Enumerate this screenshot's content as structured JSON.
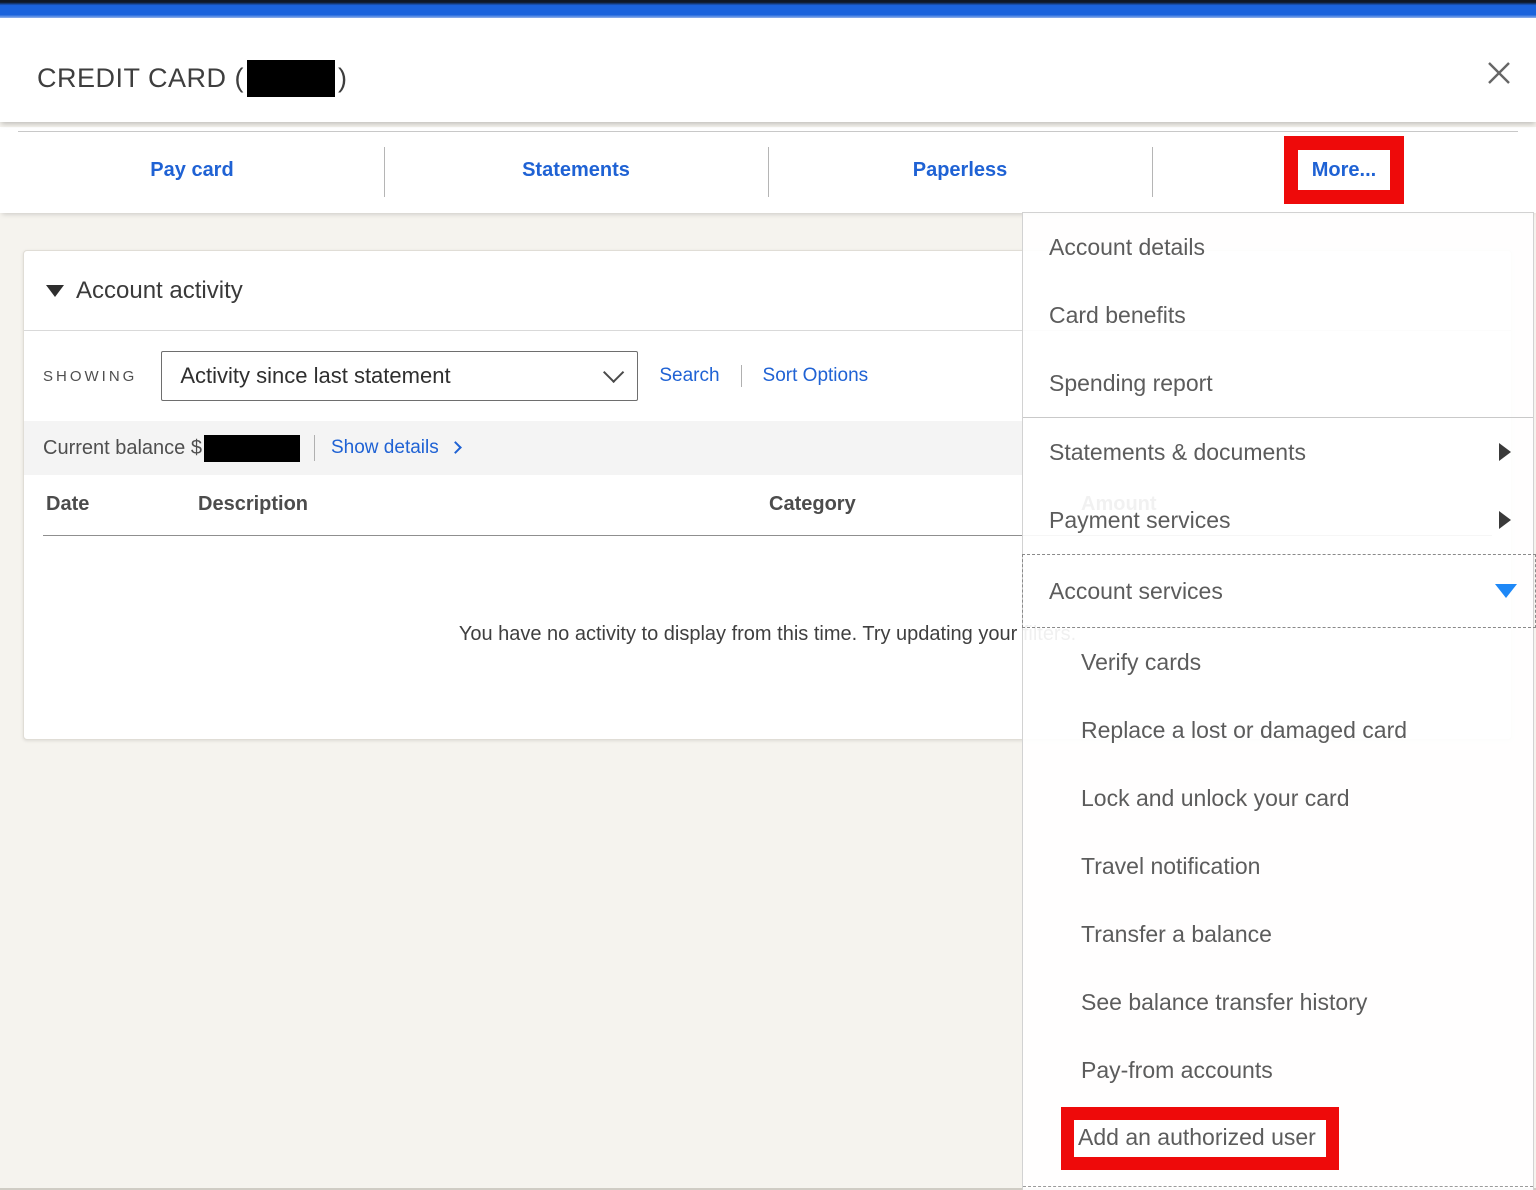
{
  "window": {
    "title_prefix": "CREDIT CARD (",
    "title_suffix": ")"
  },
  "tabs": [
    {
      "label": "Pay card"
    },
    {
      "label": "Statements"
    },
    {
      "label": "Paperless"
    },
    {
      "label": "More...",
      "annotated": true
    }
  ],
  "more_menu": {
    "items": [
      {
        "label": "Account details"
      },
      {
        "label": "Card benefits"
      },
      {
        "label": "Spending report"
      },
      {
        "label": "Statements & documents",
        "has_flyout": true
      },
      {
        "label": "Payment services",
        "has_flyout": true
      },
      {
        "label": "Account services",
        "expanded": true
      },
      {
        "label": "Verify cards",
        "sub": true
      },
      {
        "label": "Replace a lost or damaged card",
        "sub": true
      },
      {
        "label": "Lock and unlock your card",
        "sub": true
      },
      {
        "label": "Travel notification",
        "sub": true
      },
      {
        "label": "Transfer a balance",
        "sub": true
      },
      {
        "label": "See balance transfer history",
        "sub": true
      },
      {
        "label": "Pay-from accounts",
        "sub": true
      },
      {
        "label": "Add an authorized user",
        "sub": true,
        "annotated": true
      }
    ]
  },
  "activity": {
    "section_title": "Account activity",
    "showing_label": "SHOWING",
    "filter_value": "Activity since last statement",
    "search_label": "Search",
    "sort_options_label": "Sort Options",
    "balance_label": "Current balance",
    "balance_currency": "$",
    "show_details_label": "Show details",
    "table_headers": [
      "Date",
      "Description",
      "Category",
      "Amount"
    ],
    "empty_message": "You have no activity to display from this time. Try updating your filters."
  },
  "colors": {
    "link_blue": "#1f62d4",
    "annotation_red": "#ee0a0a",
    "expand_triangle_blue": "#1e88f7",
    "topbar_blue": "#1b63dc",
    "page_background": "#f5f3ee"
  }
}
